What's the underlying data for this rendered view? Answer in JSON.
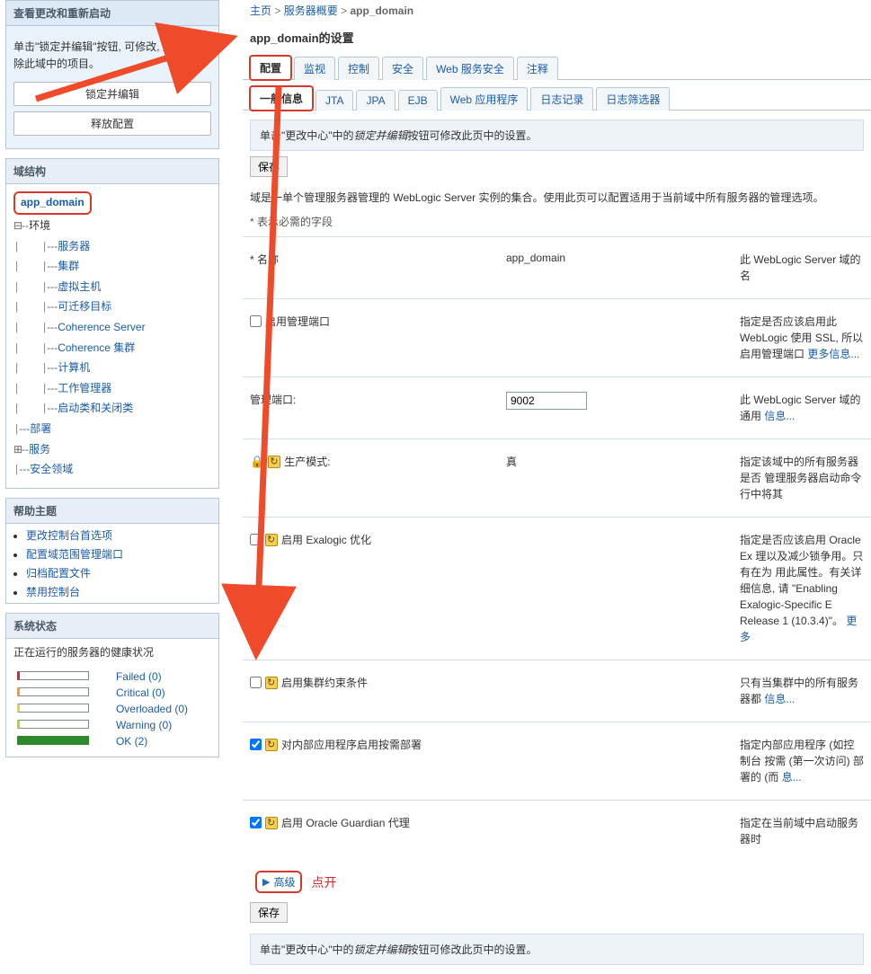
{
  "change_center": {
    "title": "查看更改和重新启动",
    "desc": "单击\"锁定并编辑\"按钮, 可修改, 添加或删除此域中的项目。",
    "btn_lock": "锁定并编辑",
    "btn_release": "释放配置"
  },
  "domain_structure": {
    "title": "域结构",
    "root": "app_domain",
    "env": "环境",
    "items": [
      "服务器",
      "集群",
      "虚拟主机",
      "可迁移目标",
      "Coherence Server",
      "Coherence 集群",
      "计算机",
      "工作管理器",
      "启动类和关闭类"
    ],
    "deploy": "部署",
    "services": "服务",
    "security_realms": "安全领域"
  },
  "help_topics": {
    "title": "帮助主题",
    "items": [
      "更改控制台首选项",
      "配置域范围管理端口",
      "归档配置文件",
      "禁用控制台"
    ]
  },
  "system_status": {
    "title": "系统状态",
    "desc": "正在运行的服务器的健康状况",
    "rows": [
      {
        "label": "Failed (0)",
        "cls": "red"
      },
      {
        "label": "Critical (0)",
        "cls": "orange"
      },
      {
        "label": "Overloaded (0)",
        "cls": "yellow"
      },
      {
        "label": "Warning (0)",
        "cls": "lime"
      },
      {
        "label": "OK (2)",
        "cls": "green"
      }
    ]
  },
  "breadcrumb": {
    "home": "主页",
    "sep": ">",
    "servers": "服务器概要",
    "current": "app_domain"
  },
  "page_title": "app_domain的设置",
  "tabs": {
    "main": [
      "配置",
      "监视",
      "控制",
      "安全",
      "Web 服务安全",
      "注释"
    ],
    "sub": [
      "一般信息",
      "JTA",
      "JPA",
      "EJB",
      "Web 应用程序",
      "日志记录",
      "日志筛选器"
    ]
  },
  "info_bar": {
    "prefix": "单击\"更改中心\"中的",
    "em": "锁定并编辑",
    "suffix": "按钮可修改此页中的设置。"
  },
  "save_label": "保存",
  "domain_desc": "域是一单个管理服务器管理的 WebLogic Server 实例的集合。使用此页可以配置适用于当前域中所有服务器的管理选项。",
  "required_note": "* 表示必需的字段",
  "props": {
    "name": {
      "label": "* 名称",
      "value": "app_domain",
      "help": "此 WebLogic Server 域的名"
    },
    "admin_port_enabled": {
      "label": "启用管理端口",
      "help": "指定是否应该启用此 WebLogic 使用 SSL, 所以启用管理端口",
      "more": "更多信息..."
    },
    "admin_port": {
      "label": "管理端口:",
      "value": "9002",
      "help": "此 WebLogic Server 域的通用",
      "more": "信息..."
    },
    "prod_mode": {
      "label": "生产模式:",
      "value": "真",
      "help": "指定该域中的所有服务器是否 管理服务器启动命令行中将其"
    },
    "exalogic": {
      "label": "启用 Exalogic 优化",
      "help": "指定是否应该启用 Oracle Ex 理以及减少锁争用。只有在为 用此属性。有关详细信息, 请 \"Enabling Exalogic-Specific E Release 1 (10.3.4)\"。",
      "more": "更多"
    },
    "cluster_constraint": {
      "label": "启用集群约束条件",
      "help": "只有当集群中的所有服务器都",
      "more": "信息..."
    },
    "ondemand_deploy": {
      "label": "对内部应用程序启用按需部署",
      "help": "指定内部应用程序 (如控制台 按需 (第一次访问) 部署的 (而",
      "more": "息..."
    },
    "guardian": {
      "label": "启用 Oracle Guardian 代理",
      "help": "指定在当前域中启动服务器时"
    }
  },
  "advanced_label": "高级",
  "click_open_label": "点开"
}
